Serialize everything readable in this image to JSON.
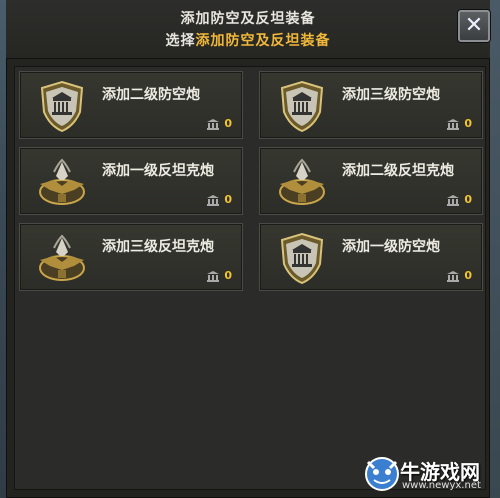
{
  "header": {
    "title": "添加防空及反坦装备",
    "subtitle_prefix": "选择",
    "subtitle_highlight": "添加防空及反坦装备"
  },
  "close_label": "✕",
  "cards": [
    {
      "label": "添加二级防空炮",
      "count": "0",
      "emblem": "shield-icon"
    },
    {
      "label": "添加三级防空炮",
      "count": "0",
      "emblem": "shield-icon"
    },
    {
      "label": "添加一级反坦克炮",
      "count": "0",
      "emblem": "eagle-emblem-icon"
    },
    {
      "label": "添加二级反坦克炮",
      "count": "0",
      "emblem": "eagle-emblem-icon"
    },
    {
      "label": "添加三级反坦克炮",
      "count": "0",
      "emblem": "eagle-emblem-icon"
    },
    {
      "label": "添加一级防空炮",
      "count": "0",
      "emblem": "shield-icon"
    }
  ],
  "watermark": {
    "text": "牛游戏网",
    "url": "www.newyx.net"
  },
  "colors": {
    "accent": "#f2b83a",
    "panel": "#232320",
    "card": "#2f302a"
  }
}
